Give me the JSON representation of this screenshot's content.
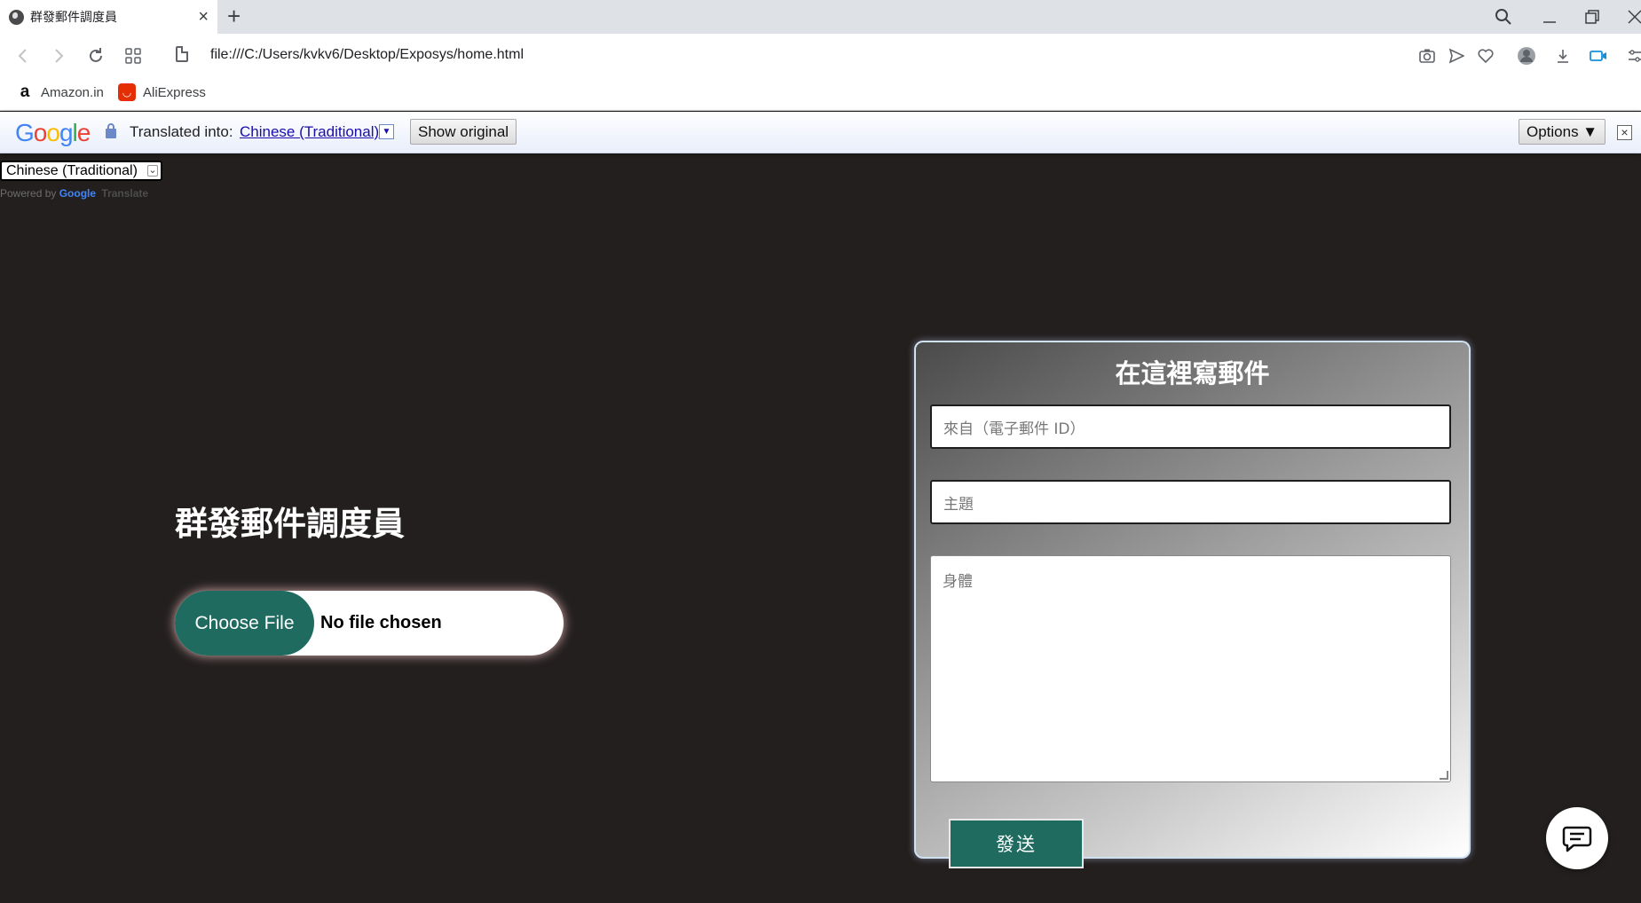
{
  "browser": {
    "tab_title": "群發郵件調度員",
    "address": "file:///C:/Users/kvkv6/Desktop/Exposys/home.html",
    "bookmarks": [
      {
        "label": "Amazon.in",
        "icon": "amazon-icon"
      },
      {
        "label": "AliExpress",
        "icon": "aliexpress-icon"
      }
    ]
  },
  "translate_bar": {
    "logo": "Google",
    "translated_into_label": "Translated into:",
    "language": "Chinese (Traditional)",
    "show_original": "Show original",
    "options": "Options ▼"
  },
  "page": {
    "language_select": "Chinese (Traditional)",
    "powered_by": "Powered by",
    "powered_google": "Google",
    "powered_translate": "Translate",
    "app_title": "群發郵件調度員",
    "file_input": {
      "button": "Choose File",
      "status": "No file chosen"
    },
    "compose": {
      "title": "在這裡寫郵件",
      "from_placeholder": "來自（電子郵件 ID）",
      "subject_placeholder": "主題",
      "body_placeholder": "身體",
      "send": "發送"
    }
  },
  "colors": {
    "page_background": "#231f1f",
    "accent_green": "#1f6b5f"
  }
}
